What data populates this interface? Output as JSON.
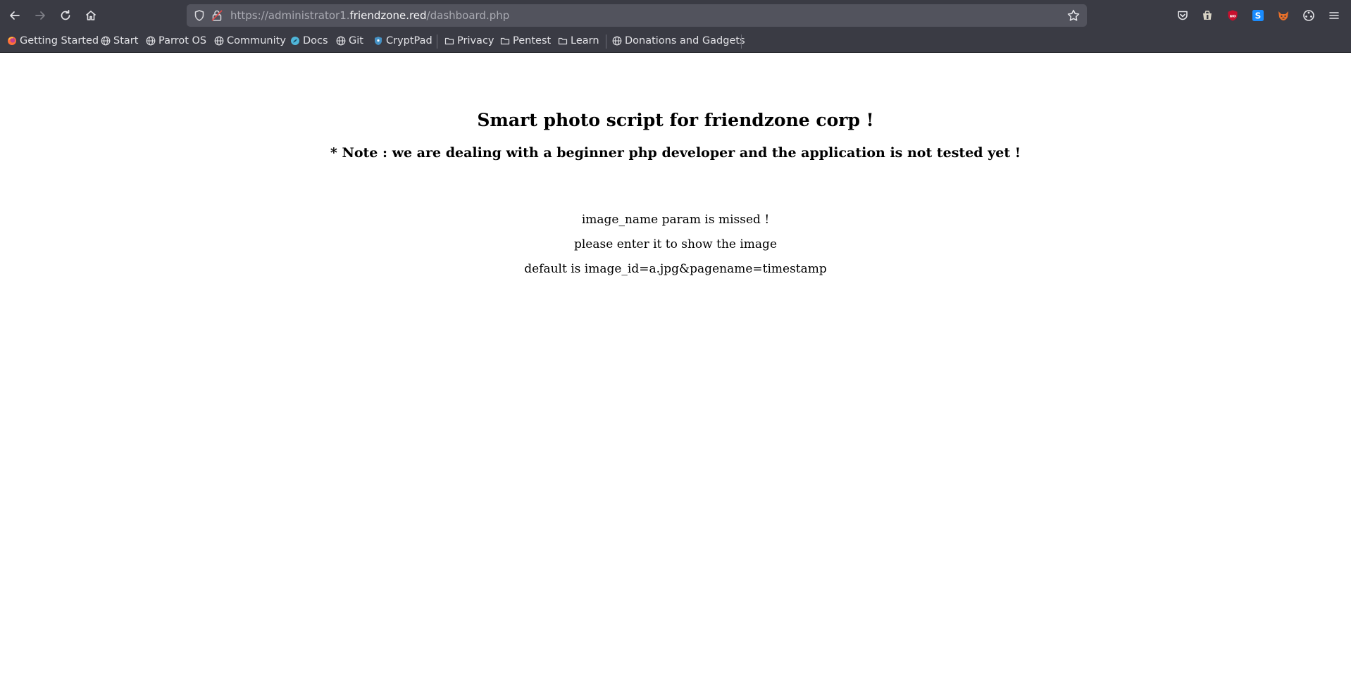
{
  "browser": {
    "url": {
      "prefix": "https://administrator1.",
      "host": "friendzone.red",
      "path": "/dashboard.php"
    },
    "bookmarks": [
      {
        "label": "Getting Started",
        "icon": "firefox-icon"
      },
      {
        "label": "Start",
        "icon": "globe-icon"
      },
      {
        "label": "Parrot OS",
        "icon": "globe-icon"
      },
      {
        "label": "Community",
        "icon": "globe-icon"
      },
      {
        "label": "Docs",
        "icon": "docs-icon"
      },
      {
        "label": "Git",
        "icon": "globe-icon"
      },
      {
        "label": "CryptPad",
        "icon": "cryptpad-icon"
      },
      {
        "label": "Privacy",
        "icon": "folder-icon"
      },
      {
        "label": "Pentest",
        "icon": "folder-icon"
      },
      {
        "label": "Learn",
        "icon": "folder-icon"
      },
      {
        "label": "Donations and Gadgets",
        "icon": "globe-icon"
      }
    ],
    "extensions": [
      "pocket-icon",
      "container-icon",
      "ublock-icon",
      "sidebar-s-icon",
      "foxyproxy-icon",
      "extensions-puzzle-icon"
    ],
    "colors": {
      "toolbar": "#3a3b44",
      "urlbar": "#52535d",
      "ublock": "#c8102e",
      "ext_blue": "#1a8cff"
    }
  },
  "page": {
    "title": "Smart photo script for friendzone corp !",
    "note": "* Note : we are dealing with a beginner php developer and the application is not tested yet !",
    "messages": [
      "image_name param is missed !",
      "please enter it to show the image",
      "default is image_id=a.jpg&pagename=timestamp"
    ]
  }
}
